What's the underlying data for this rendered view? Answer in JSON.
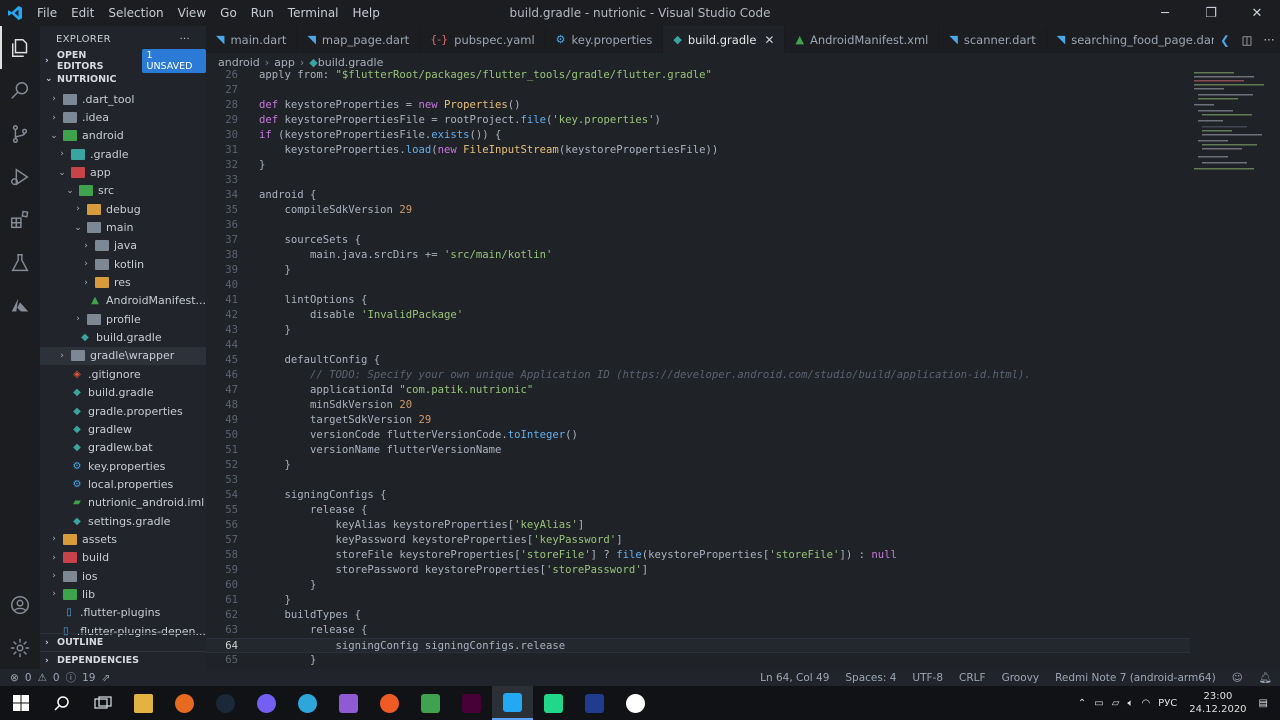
{
  "window": {
    "title": "build.gradle - nutrionic - Visual Studio Code"
  },
  "menu": [
    "File",
    "Edit",
    "Selection",
    "View",
    "Go",
    "Run",
    "Terminal",
    "Help"
  ],
  "sidebar": {
    "header": "EXPLORER",
    "open_editors": "OPEN EDITORS",
    "unsaved_badge": "1 UNSAVED",
    "project": "NUTRIONIC",
    "tree": [
      {
        "label": ".dart_tool",
        "depth": 1,
        "kind": "folder",
        "state": "closed"
      },
      {
        "label": ".idea",
        "depth": 1,
        "kind": "folder",
        "state": "closed"
      },
      {
        "label": "android",
        "depth": 1,
        "kind": "folder-green",
        "state": "open"
      },
      {
        "label": ".gradle",
        "depth": 2,
        "kind": "folder-teal",
        "state": "closed"
      },
      {
        "label": "app",
        "depth": 2,
        "kind": "folder-red",
        "state": "open"
      },
      {
        "label": "src",
        "depth": 3,
        "kind": "folder-green",
        "state": "open"
      },
      {
        "label": "debug",
        "depth": 4,
        "kind": "folder-orange",
        "state": "closed"
      },
      {
        "label": "main",
        "depth": 4,
        "kind": "folder",
        "state": "open"
      },
      {
        "label": "java",
        "depth": 5,
        "kind": "folder",
        "state": "closed"
      },
      {
        "label": "kotlin",
        "depth": 5,
        "kind": "folder",
        "state": "closed"
      },
      {
        "label": "res",
        "depth": 5,
        "kind": "folder-orange",
        "state": "closed"
      },
      {
        "label": "AndroidManifest...",
        "depth": 5,
        "kind": "android",
        "state": "file"
      },
      {
        "label": "profile",
        "depth": 4,
        "kind": "folder",
        "state": "closed"
      },
      {
        "label": "build.gradle",
        "depth": 3,
        "kind": "gradle",
        "state": "file"
      },
      {
        "label": "gradle\\wrapper",
        "depth": 2,
        "kind": "folder",
        "state": "closed",
        "selected": true
      },
      {
        "label": ".gitignore",
        "depth": 2,
        "kind": "git",
        "state": "file"
      },
      {
        "label": "build.gradle",
        "depth": 2,
        "kind": "gradle",
        "state": "file"
      },
      {
        "label": "gradle.properties",
        "depth": 2,
        "kind": "gradle",
        "state": "file"
      },
      {
        "label": "gradlew",
        "depth": 2,
        "kind": "gradle",
        "state": "file"
      },
      {
        "label": "gradlew.bat",
        "depth": 2,
        "kind": "gradle",
        "state": "file"
      },
      {
        "label": "key.properties",
        "depth": 2,
        "kind": "gear",
        "state": "file"
      },
      {
        "label": "local.properties",
        "depth": 2,
        "kind": "gear",
        "state": "file"
      },
      {
        "label": "nutrionic_android.iml",
        "depth": 2,
        "kind": "iml",
        "state": "file"
      },
      {
        "label": "settings.gradle",
        "depth": 2,
        "kind": "gradle",
        "state": "file"
      },
      {
        "label": "assets",
        "depth": 1,
        "kind": "folder-orange",
        "state": "closed"
      },
      {
        "label": "build",
        "depth": 1,
        "kind": "folder-red",
        "state": "closed"
      },
      {
        "label": "ios",
        "depth": 1,
        "kind": "folder",
        "state": "closed"
      },
      {
        "label": "lib",
        "depth": 1,
        "kind": "folder-green",
        "state": "closed"
      },
      {
        "label": ".flutter-plugins",
        "depth": 1,
        "kind": "file",
        "state": "file"
      },
      {
        "label": ".flutter-plugins-depen...",
        "depth": 1,
        "kind": "file",
        "state": "file"
      }
    ],
    "outline": "OUTLINE",
    "dependencies": "DEPENDENCIES"
  },
  "tabs": [
    {
      "label": "main.dart",
      "icon": "dart",
      "color": "#4aa8e8"
    },
    {
      "label": "map_page.dart",
      "icon": "dart",
      "color": "#4aa8e8"
    },
    {
      "label": "pubspec.yaml",
      "icon": "yaml",
      "color": "#e06c75"
    },
    {
      "label": "key.properties",
      "icon": "gear",
      "color": "#4aa8e8"
    },
    {
      "label": "build.gradle",
      "icon": "gradle",
      "color": "#3aa5a0",
      "active": true
    },
    {
      "label": "AndroidManifest.xml",
      "icon": "android",
      "color": "#3fa34d"
    },
    {
      "label": "scanner.dart",
      "icon": "dart",
      "color": "#4aa8e8"
    },
    {
      "label": "searching_food_page.dart",
      "icon": "dart",
      "color": "#4aa8e8"
    }
  ],
  "breadcrumb": [
    "android",
    "app",
    "build.gradle"
  ],
  "code": [
    {
      "n": "26",
      "html": "apply from: \"$flutterRoot/packages/flutter_tools/gradle/flutter.gradle\""
    },
    {
      "n": "27",
      "html": ""
    },
    {
      "n": "28",
      "html": "def keystoreProperties = new Properties()"
    },
    {
      "n": "29",
      "html": "def keystorePropertiesFile = rootProject.file('key.properties')"
    },
    {
      "n": "30",
      "html": "if (keystorePropertiesFile.exists()) {"
    },
    {
      "n": "31",
      "html": "    keystoreProperties.load(new FileInputStream(keystorePropertiesFile))"
    },
    {
      "n": "32",
      "html": "}"
    },
    {
      "n": "33",
      "html": ""
    },
    {
      "n": "34",
      "html": "android {"
    },
    {
      "n": "35",
      "html": "    compileSdkVersion 29"
    },
    {
      "n": "36",
      "html": ""
    },
    {
      "n": "37",
      "html": "    sourceSets {"
    },
    {
      "n": "38",
      "html": "        main.java.srcDirs += 'src/main/kotlin'"
    },
    {
      "n": "39",
      "html": "    }"
    },
    {
      "n": "40",
      "html": ""
    },
    {
      "n": "41",
      "html": "    lintOptions {"
    },
    {
      "n": "42",
      "html": "        disable 'InvalidPackage'"
    },
    {
      "n": "43",
      "html": "    }"
    },
    {
      "n": "44",
      "html": ""
    },
    {
      "n": "45",
      "html": "    defaultConfig {"
    },
    {
      "n": "46",
      "html": "        // TODO: Specify your own unique Application ID (https://developer.android.com/studio/build/application-id.html)."
    },
    {
      "n": "47",
      "html": "        applicationId \"com.patik.nutrionic\""
    },
    {
      "n": "48",
      "html": "        minSdkVersion 20"
    },
    {
      "n": "49",
      "html": "        targetSdkVersion 29"
    },
    {
      "n": "50",
      "html": "        versionCode flutterVersionCode.toInteger()"
    },
    {
      "n": "51",
      "html": "        versionName flutterVersionName"
    },
    {
      "n": "52",
      "html": "    }"
    },
    {
      "n": "53",
      "html": ""
    },
    {
      "n": "54",
      "html": "    signingConfigs {"
    },
    {
      "n": "55",
      "html": "        release {"
    },
    {
      "n": "56",
      "html": "            keyAlias keystoreProperties['keyAlias']"
    },
    {
      "n": "57",
      "html": "            keyPassword keystoreProperties['keyPassword']"
    },
    {
      "n": "58",
      "html": "            storeFile keystoreProperties['storeFile'] ? file(keystoreProperties['storeFile']) : null"
    },
    {
      "n": "59",
      "html": "            storePassword keystoreProperties['storePassword']"
    },
    {
      "n": "60",
      "html": "        }"
    },
    {
      "n": "61",
      "html": "    }"
    },
    {
      "n": "62",
      "html": "    buildTypes {"
    },
    {
      "n": "63",
      "html": "        release {"
    },
    {
      "n": "64",
      "html": "            signingConfig signingConfigs.release"
    },
    {
      "n": "65",
      "html": "        }"
    }
  ],
  "current_line": "64",
  "status": {
    "errors": "0",
    "warnings": "0",
    "info": "19",
    "position": "Ln 64, Col 49",
    "spaces": "Spaces: 4",
    "encoding": "UTF-8",
    "eol": "CRLF",
    "language": "Groovy",
    "device": "Redmi Note 7 (android-arm64)"
  },
  "taskbar": {
    "apps": [
      {
        "name": "file-explorer",
        "color": "#e3b341"
      },
      {
        "name": "firefox",
        "color": "#e66a1f"
      },
      {
        "name": "steam",
        "color": "#1b2838"
      },
      {
        "name": "viber",
        "color": "#7360f2"
      },
      {
        "name": "telegram",
        "color": "#2ea6da"
      },
      {
        "name": "visual-studio",
        "color": "#8f5bd5"
      },
      {
        "name": "postman",
        "color": "#ef5b25"
      },
      {
        "name": "inkscape-like",
        "color": "#3fa34d"
      },
      {
        "name": "adobe-xd",
        "color": "#470137"
      },
      {
        "name": "vscode",
        "color": "#23a9f2"
      },
      {
        "name": "pycharm",
        "color": "#21d789"
      },
      {
        "name": "jetbrains",
        "color": "#1f3c8f"
      },
      {
        "name": "signal",
        "color": "#ffffff"
      }
    ],
    "lang": "РУС",
    "time": "23:00",
    "date": "24.12.2020"
  }
}
